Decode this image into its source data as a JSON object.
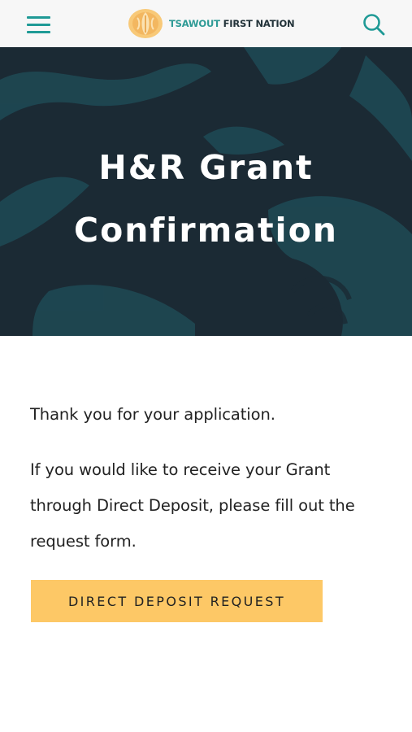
{
  "header": {
    "logo_text_primary": "TSAWOUT",
    "logo_text_secondary": "FIRST NATION",
    "menu_icon": "hamburger-menu-icon",
    "search_icon": "search-icon",
    "accent_color": "#1f9a96",
    "logo_color": "#f3b760"
  },
  "hero": {
    "title": "H&R Grant Confirmation",
    "background_color": "#1b2a34",
    "pattern_color": "#1e4a55"
  },
  "main": {
    "paragraph_1": "Thank you for your application.",
    "paragraph_2": "If you would like to receive your Grant through Direct Deposit, please fill out the request form.",
    "button_label": "DIRECT DEPOSIT REQUEST",
    "button_color": "#fdc866"
  }
}
